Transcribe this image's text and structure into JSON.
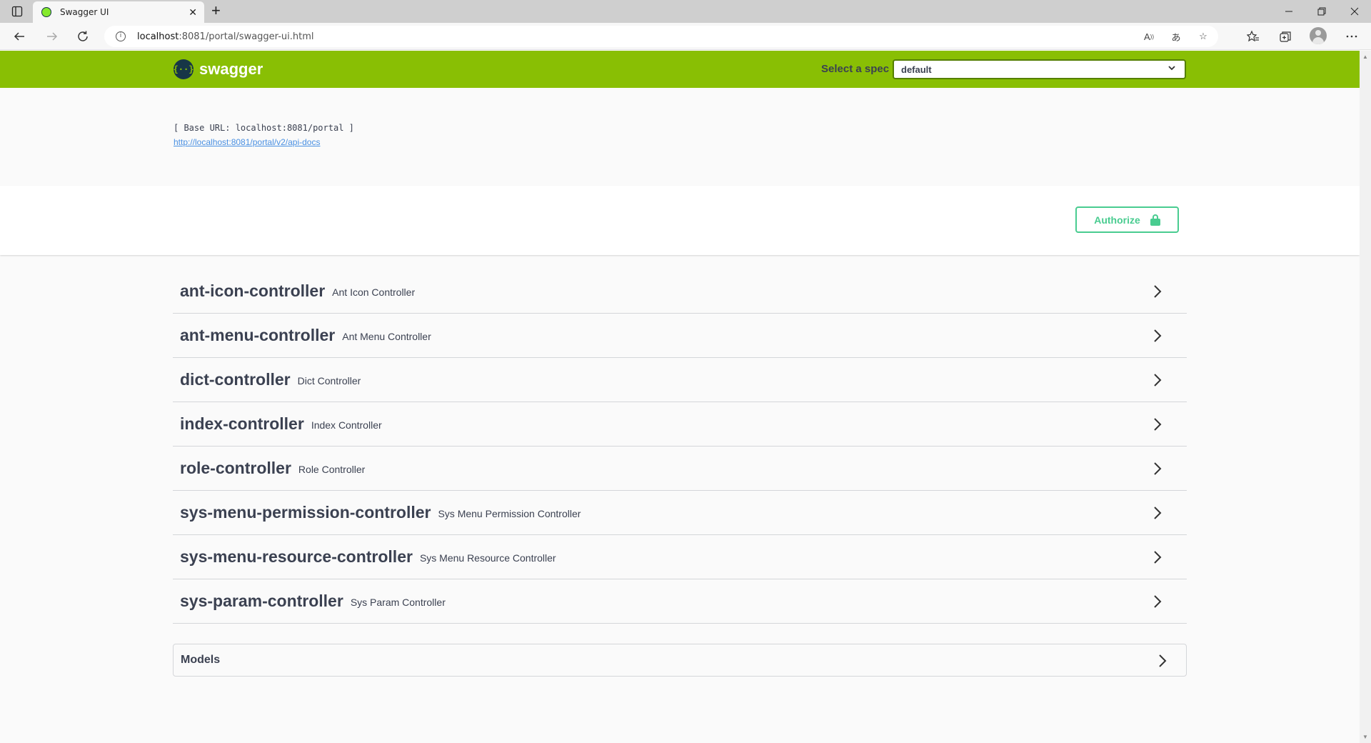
{
  "browser": {
    "tab_title": "Swagger UI",
    "tab_close": "✕",
    "new_tab": "+",
    "url_host": "localhost",
    "url_path": ":8081/portal/swagger-ui.html"
  },
  "header": {
    "logo_text": "swagger",
    "logo_mark": "{··}",
    "spec_label": "Select a spec",
    "spec_value": "default"
  },
  "info": {
    "base_url": "[ Base URL: localhost:8081/portal ]",
    "docs_url": "http://localhost:8081/portal/v2/api-docs"
  },
  "auth": {
    "label": "Authorize"
  },
  "tags": [
    {
      "name": "ant-icon-controller",
      "description": "Ant Icon Controller"
    },
    {
      "name": "ant-menu-controller",
      "description": "Ant Menu Controller"
    },
    {
      "name": "dict-controller",
      "description": "Dict Controller"
    },
    {
      "name": "index-controller",
      "description": "Index Controller"
    },
    {
      "name": "role-controller",
      "description": "Role Controller"
    },
    {
      "name": "sys-menu-permission-controller",
      "description": "Sys Menu Permission Controller"
    },
    {
      "name": "sys-menu-resource-controller",
      "description": "Sys Menu Resource Controller"
    },
    {
      "name": "sys-param-controller",
      "description": "Sys Param Controller"
    }
  ],
  "models": {
    "title": "Models"
  },
  "colors": {
    "topbar": "#89bf04",
    "authorize": "#49cc90",
    "link": "#4990e2",
    "text": "#3b4151"
  }
}
